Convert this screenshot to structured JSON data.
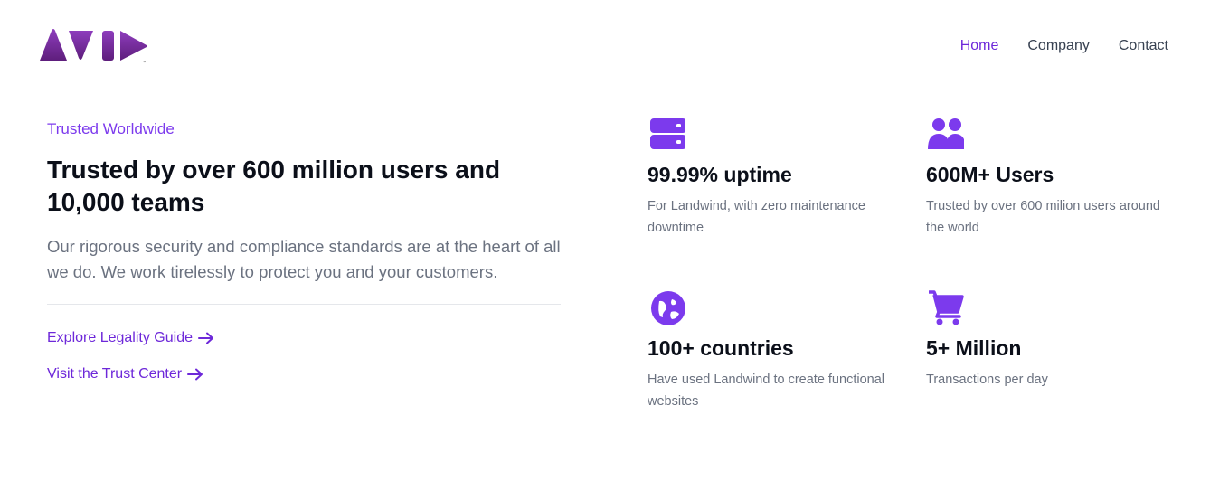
{
  "brand": {
    "logo_text": "AVID",
    "accent": "#7c3aed"
  },
  "nav": {
    "items": [
      {
        "label": "Home",
        "active": true
      },
      {
        "label": "Company",
        "active": false
      },
      {
        "label": "Contact",
        "active": false
      }
    ]
  },
  "hero": {
    "eyebrow": "Trusted Worldwide",
    "headline": "Trusted by over 600 million users and 10,000 teams",
    "lead": "Our rigorous security and compliance standards are at the heart of all we do. We work tirelessly to protect you and your customers.",
    "links": [
      {
        "label": "Explore Legality Guide",
        "icon": "arrow-right-icon"
      },
      {
        "label": "Visit the Trust Center",
        "icon": "arrow-right-icon"
      }
    ]
  },
  "stats": [
    {
      "icon": "server-icon",
      "title": "99.99% uptime",
      "desc": "For Landwind, with zero maintenance downtime"
    },
    {
      "icon": "users-icon",
      "title": "600M+ Users",
      "desc": "Trusted by over 600 milion users around the world"
    },
    {
      "icon": "globe-icon",
      "title": "100+ countries",
      "desc": "Have used Landwind to create functional websites"
    },
    {
      "icon": "cart-icon",
      "title": "5+ Million",
      "desc": "Transactions per day"
    }
  ]
}
